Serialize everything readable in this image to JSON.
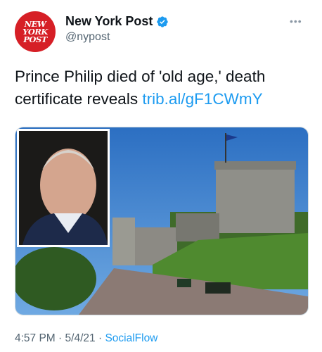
{
  "account": {
    "logo_lines": [
      "NEW",
      "YORK",
      "POST"
    ],
    "display_name": "New York Post",
    "handle": "@nypost",
    "verified": true
  },
  "more_label": "•••",
  "tweet": {
    "text": "Prince Philip died of 'old age,' death certificate reveals",
    "link": "trib.al/gF1CWmY"
  },
  "media": {
    "description_icon": "photo",
    "inset_icon": "portrait"
  },
  "meta": {
    "time": "4:57 PM",
    "separator1": "·",
    "date": "5/4/21",
    "separator2": "·",
    "source": "SocialFlow"
  },
  "colors": {
    "brand": "#d61f26",
    "link": "#1d9bf0",
    "muted": "#536471"
  }
}
